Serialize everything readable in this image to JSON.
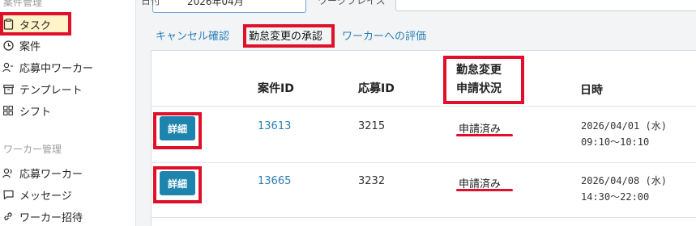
{
  "sidebar": {
    "section1_title": "案件管理",
    "items": [
      {
        "label": "タスク",
        "icon": "clipboard-icon"
      },
      {
        "label": "案件",
        "icon": "clock-icon"
      },
      {
        "label": "応募中ワーカー",
        "icon": "person-icon"
      },
      {
        "label": "テンプレート",
        "icon": "archive-icon"
      },
      {
        "label": "シフト",
        "icon": "grid-icon"
      }
    ],
    "section2_title": "ワーカー管理",
    "items2": [
      {
        "label": "応募ワーカー",
        "icon": "people-icon"
      },
      {
        "label": "メッセージ",
        "icon": "chat-icon"
      },
      {
        "label": "ワーカー招待",
        "icon": "link-icon"
      }
    ]
  },
  "topbar": {
    "label1": "日付",
    "select_value": "2026年04月",
    "label2": "ワークプレイス"
  },
  "tabs": [
    {
      "label": "キャンセル確認"
    },
    {
      "label": "勤怠変更の承認"
    },
    {
      "label": "ワーカーへの評価"
    }
  ],
  "table": {
    "headers": {
      "case_id": "案件ID",
      "apply_id": "応募ID",
      "status_line1": "勤怠変更",
      "status_line2": "申請状況",
      "datetime": "日時"
    },
    "rows": [
      {
        "button": "詳細",
        "case_id": "13613",
        "apply_id": "3215",
        "status": "申請済み",
        "date": "2026/04/01 (水)",
        "time": "09:10〜10:10"
      },
      {
        "button": "詳細",
        "case_id": "13665",
        "apply_id": "3232",
        "status": "申請済み",
        "date": "2026/04/08 (水)",
        "time": "14:30〜22:00"
      }
    ]
  },
  "colors": {
    "accent": "#1d84ae",
    "highlight": "#e0102a",
    "link": "#2a7fb7"
  }
}
